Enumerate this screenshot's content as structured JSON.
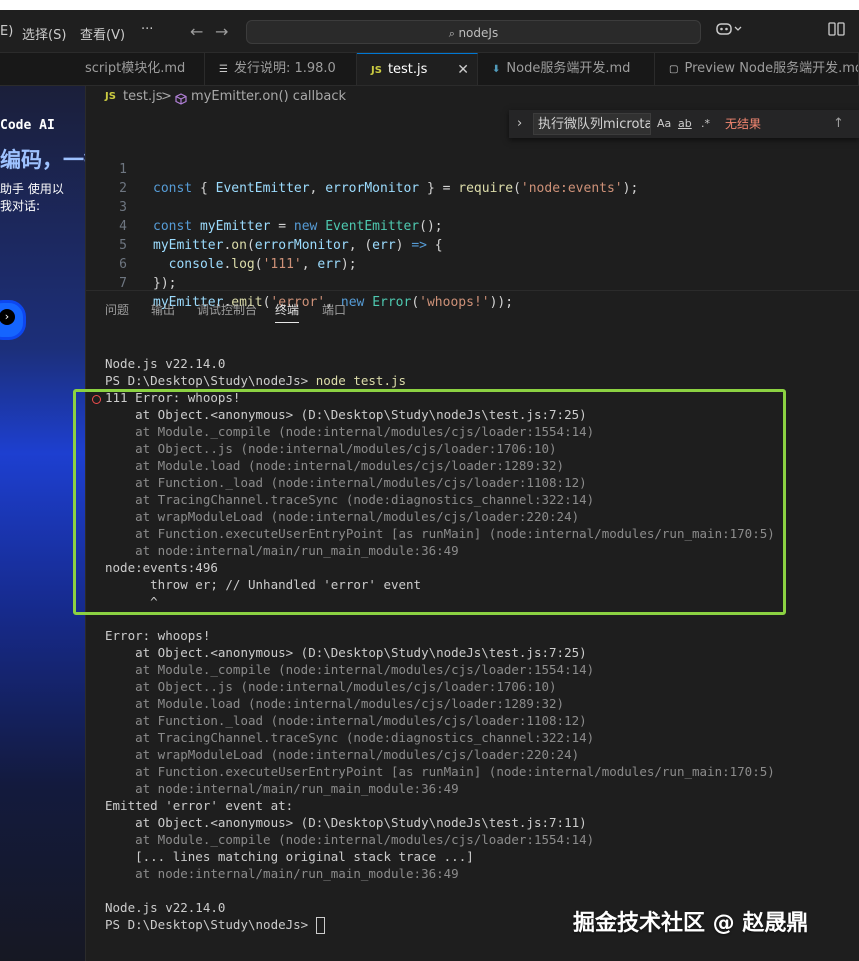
{
  "titlebar": {
    "menu": [
      "E)",
      "选择(S)",
      "查看(V)",
      "···"
    ],
    "back_glyph": "←",
    "forward_glyph": "→",
    "command_center": "nodeJs",
    "copilot_icon": "copilot-icon",
    "layout_icon": "layout-icon"
  },
  "tabs": [
    {
      "label": "script模块化.md",
      "active": false
    },
    {
      "label": "发行说明: 1.98.0",
      "active": false
    },
    {
      "label": "test.js",
      "active": true,
      "badge": "JS"
    },
    {
      "label": "Node服务端开发.md",
      "active": false
    },
    {
      "label": "Preview Node服务端开发.md",
      "active": false
    }
  ],
  "sidebar": {
    "promo_title": "Code AI",
    "promo_big": "编码，一键",
    "promo_line1": "助手 使用以",
    "promo_line2": "我对话:",
    "button_icon": "arrow-right-icon"
  },
  "breadcrumb": {
    "file": "test.js",
    "separator": ">",
    "symbol": "myEmitter.on() callback"
  },
  "find": {
    "query": "执行微队列microtas",
    "opt_case": "Aa",
    "opt_word": "ab",
    "opt_regex": ".*",
    "result": "无结果",
    "up_glyph": "↑"
  },
  "code_lines": [
    {
      "n": "1"
    },
    {
      "n": "2"
    },
    {
      "n": "3"
    },
    {
      "n": "4"
    },
    {
      "n": "5"
    },
    {
      "n": "6"
    },
    {
      "n": "7"
    }
  ],
  "panel_tabs": [
    "问题",
    "输出",
    "调试控制台",
    "终端",
    "端口"
  ],
  "terminal": {
    "l1": "Node.js v22.14.0",
    "prompt1": "PS D:\\Desktop\\Study\\nodeJs> ",
    "cmd1": "node test.js",
    "err1": "111 Error: whoops!",
    "s1": "    at Object.<anonymous> (D:\\Desktop\\Study\\nodeJs\\test.js:7:25)",
    "s2": "    at Module._compile (node:internal/modules/cjs/loader:1554:14)",
    "s3": "    at Object..js (node:internal/modules/cjs/loader:1706:10)",
    "s4": "    at Module.load (node:internal/modules/cjs/loader:1289:32)",
    "s5": "    at Function._load (node:internal/modules/cjs/loader:1108:12)",
    "s6": "    at TracingChannel.traceSync (node:diagnostics_channel:322:14)",
    "s7": "    at wrapModuleLoad (node:internal/modules/cjs/loader:220:24)",
    "s8": "    at Function.executeUserEntryPoint [as runMain] (node:internal/modules/run_main:170:5)",
    "s9": "    at node:internal/main/run_main_module:36:49",
    "ev": "node:events:496",
    "throw": "      throw er; // Unhandled 'error' event",
    "caret": "      ^",
    "err2": "Error: whoops!",
    "e1": "    at Object.<anonymous> (D:\\Desktop\\Study\\nodeJs\\test.js:7:25)",
    "e2": "    at Module._compile (node:internal/modules/cjs/loader:1554:14)",
    "e3": "    at Object..js (node:internal/modules/cjs/loader:1706:10)",
    "e4": "    at Module.load (node:internal/modules/cjs/loader:1289:32)",
    "e5": "    at Function._load (node:internal/modules/cjs/loader:1108:12)",
    "e6": "    at TracingChannel.traceSync (node:diagnostics_channel:322:14)",
    "e7": "    at wrapModuleLoad (node:internal/modules/cjs/loader:220:24)",
    "e8": "    at Function.executeUserEntryPoint [as runMain] (node:internal/modules/run_main:170:5)",
    "e9": "    at node:internal/main/run_main_module:36:49",
    "emitted": "Emitted 'error' event at:",
    "m1": "    at Object.<anonymous> (D:\\Desktop\\Study\\nodeJs\\test.js:7:11)",
    "m2": "    at Module._compile (node:internal/modules/cjs/loader:1554:14)",
    "m3": "    [... lines matching original stack trace ...]",
    "m4": "    at node:internal/main/run_main_module:36:49",
    "l2": "Node.js v22.14.0",
    "prompt2": "PS D:\\Desktop\\Study\\nodeJs> "
  },
  "watermark": "掘金技术社区 @ 赵晟鼎",
  "colors": {
    "accent": "#0078d4",
    "highlight": "#8cd242",
    "error": "#f14c4c",
    "keyword": "#569cd6",
    "string": "#ce9178"
  }
}
